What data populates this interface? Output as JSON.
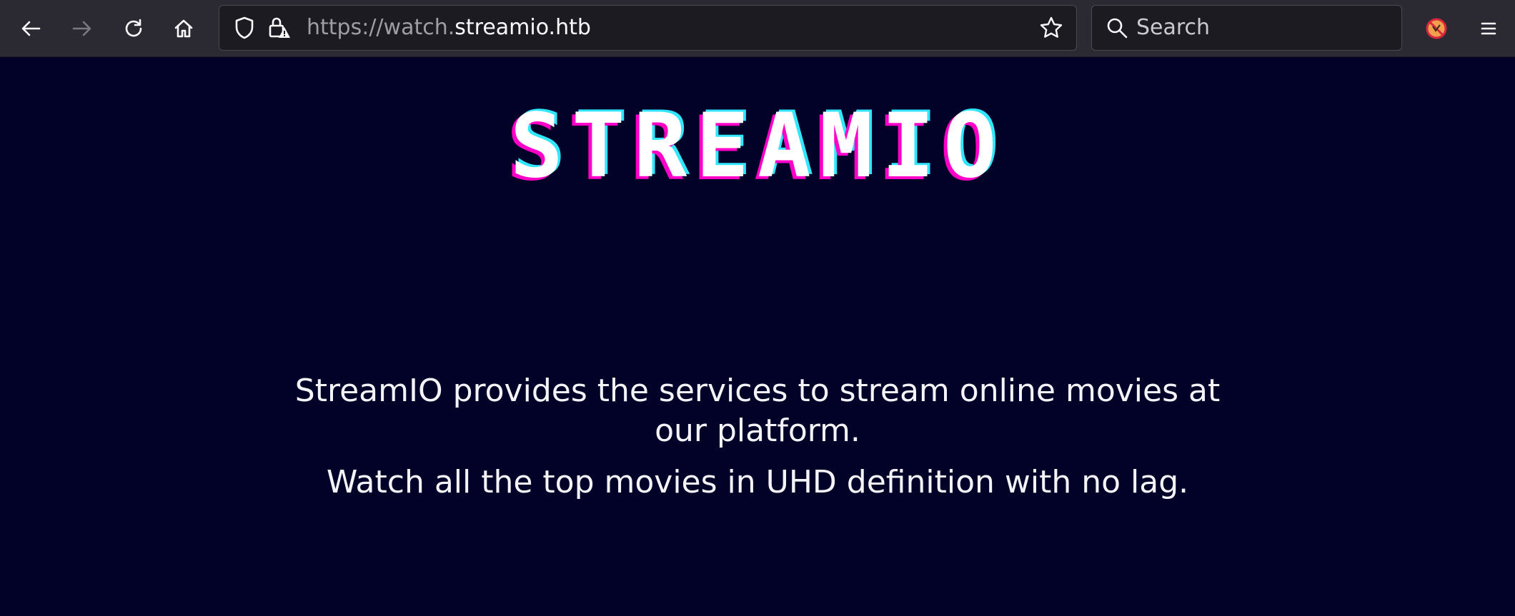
{
  "browser": {
    "url_scheme": "https://watch.",
    "url_host": "streamio.htb",
    "search_placeholder": "Search",
    "icons": [
      "back-arrow-icon",
      "forward-arrow-icon",
      "reload-icon",
      "home-icon",
      "shield-icon",
      "insecure-lock-icon",
      "bookmark-star-icon",
      "search-icon",
      "extension-icon",
      "menu-icon"
    ]
  },
  "page": {
    "logo": "STREAMIO",
    "paragraph1": "StreamIO provides the services to stream online movies at our platform.",
    "paragraph2": "Watch all the top movies in UHD definition with no lag."
  },
  "colors": {
    "background": "#020229",
    "toolbar": "#2b2a33",
    "logo_magenta": "#ff00c8",
    "logo_cyan": "#31e6ff"
  }
}
